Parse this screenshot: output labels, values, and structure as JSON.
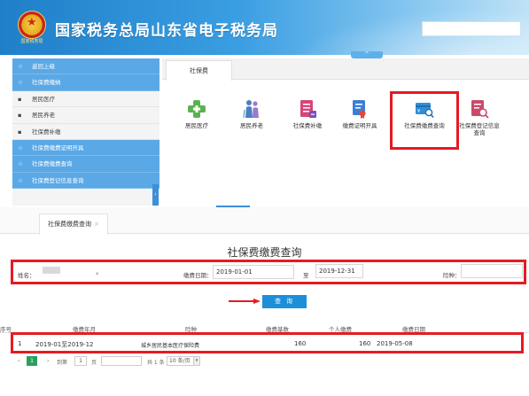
{
  "header": {
    "title": "国家税务总局山东省电子税务局",
    "emblem_caption": "国家税务局",
    "collapse_glyph": "^"
  },
  "sidebar": {
    "items": [
      {
        "mark": "☆",
        "label": "返回上级",
        "style": "blue"
      },
      {
        "mark": "☆",
        "label": "社保费缴纳",
        "style": "blue"
      },
      {
        "mark": "▪",
        "label": "居民医疗",
        "style": "sub"
      },
      {
        "mark": "▪",
        "label": "居民养老",
        "style": "sub"
      },
      {
        "mark": "▪",
        "label": "社保费补缴",
        "style": "sub"
      },
      {
        "mark": "☆",
        "label": "社保费缴费证明开具",
        "style": "blue"
      },
      {
        "mark": "☆",
        "label": "社保费缴费查询",
        "style": "blue"
      },
      {
        "mark": "☆",
        "label": "社保费登记信息查询",
        "style": "blue"
      }
    ],
    "scroll_glyph": "‹"
  },
  "top_tabs": {
    "active": "社保费"
  },
  "tiles": [
    {
      "label": "居民医疗",
      "icon": "medical-cross-icon",
      "color": "#5ab24f"
    },
    {
      "label": "居民养老",
      "icon": "elderly-people-icon",
      "color": "#4a7fc1"
    },
    {
      "label": "社保费补缴",
      "icon": "form-list-icon",
      "color": "#d6457a"
    },
    {
      "label": "缴费证明开具",
      "icon": "certificate-icon",
      "color": "#3b7fd4"
    },
    {
      "label": "社保费缴费查询",
      "icon": "card-search-icon",
      "color": "#2f8fd8"
    },
    {
      "label": "社保费登记信息查询",
      "icon": "doc-search-icon",
      "color": "#c94b6a"
    }
  ],
  "lower_tab": {
    "label": "社保费缴费查询",
    "close": "×"
  },
  "query_title": "社保费缴费查询",
  "form": {
    "name_label": "姓名：",
    "name_select_arrow": "▾",
    "date_label": "缴费日期：",
    "date_from": "2019-01-01",
    "to_label": "至",
    "date_to": "2019-12-31",
    "type_label": "险种："
  },
  "search_button": "查 询",
  "table": {
    "headers": [
      "序号",
      "缴费年月",
      "险种",
      "缴费基数",
      "个人缴费",
      "缴费日期"
    ],
    "rows": [
      {
        "no": "1",
        "period": "2019-01至2019-12",
        "type": "城乡居民基本医疗保险费",
        "base": "160",
        "personal": "160",
        "date": "2019-05-08"
      }
    ]
  },
  "pager": {
    "prev": "‹",
    "current": "1",
    "next": "›",
    "goto_label": "到第",
    "goto_value": "1",
    "page_unit": "页",
    "total": "共 1 条",
    "per_page": "10 条/页"
  },
  "colors": {
    "accent": "#1d8fd8",
    "highlight": "#e41b23",
    "sidebar": "#5aa8e6"
  }
}
